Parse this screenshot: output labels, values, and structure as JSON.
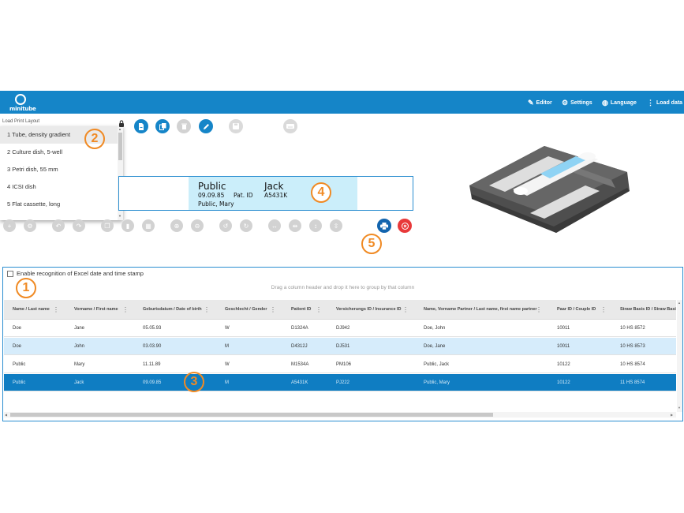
{
  "navbar": {
    "logo_text": "minitube",
    "items": [
      {
        "icon": "pencil-icon",
        "glyph": "✎",
        "label": "Editor"
      },
      {
        "icon": "gear-icon",
        "glyph": "⚙",
        "label": "Settings"
      },
      {
        "icon": "globe-icon",
        "glyph": "◍",
        "label": "Language"
      },
      {
        "icon": "more-vert-icon",
        "glyph": "⋮",
        "label": "Load data"
      }
    ]
  },
  "layout_dropdown": {
    "header": "Load Print Layout",
    "items": [
      "1 Tube, density gradient",
      "2 Culture dish, 5-well",
      "3 Petri dish, 55 mm",
      "4 ICSI dish",
      "5 Flat cassette, long"
    ],
    "selected_index": 0
  },
  "label_preview": {
    "first_name": "Public",
    "last_name": "Jack",
    "dob": "09.09.85",
    "patient_id_label": "Pat. ID",
    "patient_id": "A5431K",
    "partner": "Public, Mary"
  },
  "callouts": [
    "1",
    "2",
    "3",
    "4",
    "5"
  ],
  "grid": {
    "excel_checkbox_label": "Enable recognition of Excel date and time stamp",
    "group_hint": "Drag a column header and drop it here to group by that column",
    "columns": [
      "Name / Last name",
      "Vorname / First name",
      "Geburtsdatum / Date of birth",
      "Geschlecht / Gender",
      "Patient ID",
      "Versicherungs ID / Insurance ID",
      "Name, Vorname Partner / Last name, first name partner",
      "Paar ID / Couple ID",
      "Straw Basis ID / Straw Basic"
    ],
    "rows": [
      [
        "Doe",
        "Jane",
        "05.05.93",
        "W",
        "D1324A",
        "DJ942",
        "Doe, John",
        "10011",
        "10 HS 8572"
      ],
      [
        "Doe",
        "John",
        "03.03.90",
        "M",
        "D4312J",
        "DJ531",
        "Doe, Jane",
        "10011",
        "10 HS 8573"
      ],
      [
        "Public",
        "Mary",
        "11.11.89",
        "W",
        "M1534A",
        "PM106",
        "Public, Jack",
        "10122",
        "10 HS 8574"
      ],
      [
        "Public",
        "Jack",
        "09.09.85",
        "M",
        "A5431K",
        "PJ222",
        "Public, Mary",
        "10122",
        "11 HS 8574"
      ]
    ],
    "selected_row_index": 3,
    "highlighted_row_index": 1
  },
  "colors": {
    "primary": "#1585c8",
    "selected_row": "#0f7dc2",
    "highlight_row": "#d6ecfb",
    "label_cell": "#cbeefa",
    "callout": "#f08a24",
    "cancel": "#e8393a"
  }
}
